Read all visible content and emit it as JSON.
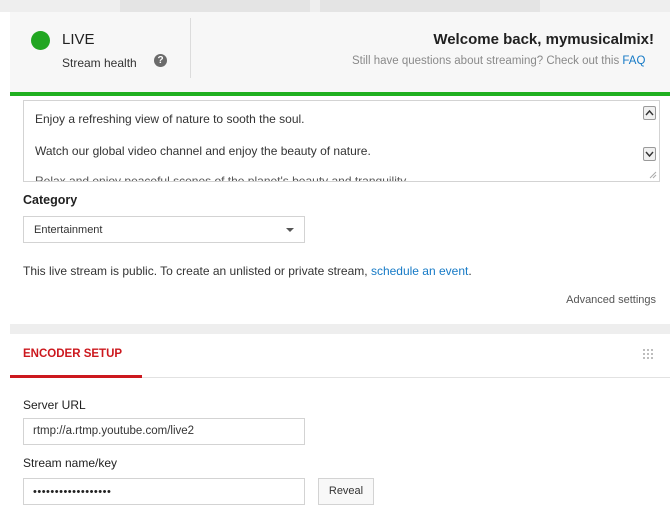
{
  "header": {
    "live_label": "LIVE",
    "stream_health_label": "Stream health",
    "help_glyph": "?",
    "welcome": "Welcome back, mymusicalmix!",
    "faq_text": "Still have questions about streaming? Check out this ",
    "faq_link": "FAQ",
    "status_color": "#21a621"
  },
  "description": {
    "lines": [
      "Enjoy a refreshing view of nature to sooth the soul.",
      "Watch our global video channel and enjoy the beauty of nature.",
      "Relax and enjoy peaceful scenes of the planet's beauty and tranquility."
    ]
  },
  "category": {
    "label": "Category",
    "selected": "Entertainment"
  },
  "privacy": {
    "text": "This live stream is public. To create an unlisted or private stream, ",
    "link": "schedule an event",
    "suffix": "."
  },
  "advanced_settings": "Advanced settings",
  "encoder": {
    "tab_label": "ENCODER SETUP",
    "accent_color": "#cc181e",
    "server_url_label": "Server URL",
    "server_url_value": "rtmp://a.rtmp.youtube.com/live2",
    "stream_key_label": "Stream name/key",
    "stream_key_masked": "••••••••••••••••••",
    "reveal_label": "Reveal"
  }
}
